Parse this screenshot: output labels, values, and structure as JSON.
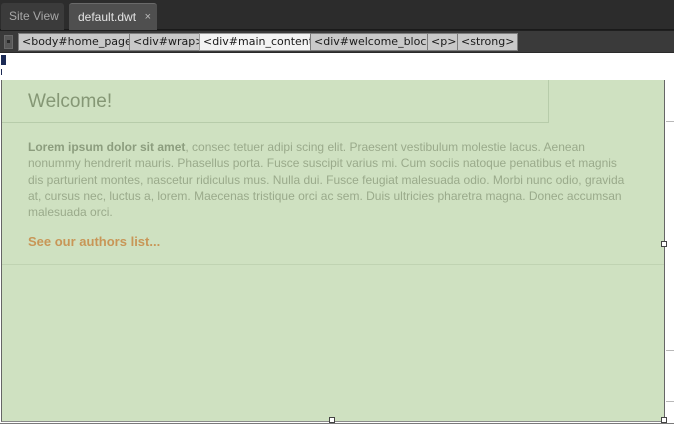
{
  "tabs": {
    "site_view": "Site View",
    "document": "default.dwt",
    "close_glyph": "×"
  },
  "tag_selector": {
    "tags": [
      "<body#home_page>",
      "<div#wrap>",
      "<div#main_content>",
      "<div#welcome_block>",
      "<p>",
      "<strong>"
    ],
    "selected_index": 2
  },
  "content": {
    "heading": "Welcome!",
    "paragraph_bold": "Lorem ipsum dolor sit amet",
    "paragraph_rest": ", consec tetuer adipi scing elit. Praesent vestibulum molestie lacus. Aenean nonummy hendrerit mauris. Phasellus porta. Fusce suscipit varius mi. Cum sociis natoque penatibus et magnis dis parturient montes, nascetur ridiculus mus. Nulla dui. Fusce feugiat malesuada odio. Morbi nunc odio, gravida at, cursus nec, luctus a, lorem. Maecenas tristique orci ac sem. Duis ultricies pharetra magna. Donec accumsan malesuada orci.",
    "link": "See our authors list..."
  },
  "colors": {
    "main_content_bg": "#cfe1c1",
    "heading": "#859775",
    "body_text": "#9aaa8b",
    "link": "#c89657"
  }
}
